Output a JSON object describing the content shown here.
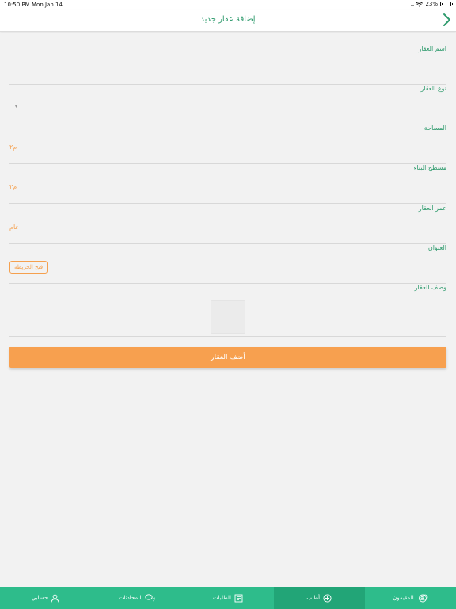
{
  "status_bar": {
    "time": "10:50 PM",
    "date": "Mon Jan 14",
    "battery": "23%",
    "battery_level": 0.23
  },
  "nav": {
    "title": "إضافة عقار جديد"
  },
  "form": {
    "name_label": "اسم العقار",
    "type_label": "نوع العقار",
    "area_label": "المساحة",
    "area_unit": "م٢",
    "building_label": "مسطح البناء",
    "building_unit": "م٢",
    "age_label": "عمر العقار",
    "age_unit": "عام",
    "address_label": "العنوان",
    "map_button": "فتح الخريطة",
    "description_label": "وصف العقار",
    "submit": "أضف العقار"
  },
  "tabs": [
    {
      "label": "المقيمون",
      "icon": "residents-icon"
    },
    {
      "label": "أطلب",
      "icon": "add-circle-icon"
    },
    {
      "label": "الطلبات",
      "icon": "requests-icon"
    },
    {
      "label": "المحادثات",
      "icon": "chat-icon"
    },
    {
      "label": "حسابي",
      "icon": "user-icon"
    }
  ],
  "colors": {
    "primary": "#2ebc8b",
    "primary_dark": "#22a577",
    "accent": "#f7a04f",
    "title": "#2d9a6c"
  }
}
